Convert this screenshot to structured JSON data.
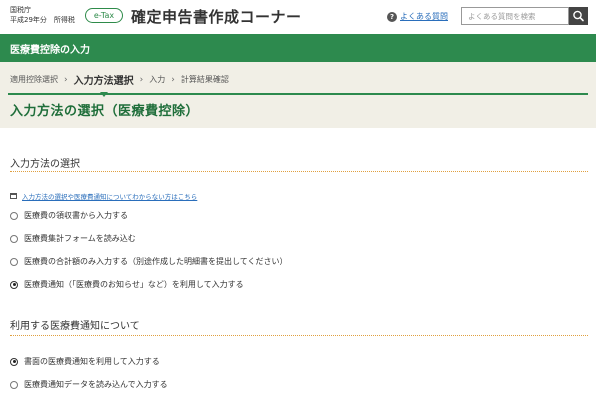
{
  "header": {
    "agency": "国税庁",
    "year": "平成29年分　所得税",
    "etax_badge": "e-Tax",
    "site_title": "確定申告書作成コーナー",
    "faq_link": "よくある質問",
    "search_placeholder": "よくある質問を検索"
  },
  "section_bar": {
    "title": "医療費控除の入力"
  },
  "steps": [
    {
      "label": "適用控除選択",
      "current": false
    },
    {
      "label": "入力方法選択",
      "current": true
    },
    {
      "label": "入力",
      "current": false
    },
    {
      "label": "計算結果確認",
      "current": false
    }
  ],
  "page_title": "入力方法の選択（医療費控除）",
  "input_method": {
    "heading": "入力方法の選択",
    "help_link": "入力方法の選択や医療費通知についてわからない方はこちら",
    "options": [
      {
        "label": "医療費の領収書から入力する",
        "checked": false
      },
      {
        "label": "医療費集計フォームを読み込む",
        "checked": false
      },
      {
        "label": "医療費の合計額のみ入力する（別途作成した明細書を提出してください）",
        "checked": false
      },
      {
        "label": "医療費通知（「医療費のお知らせ」など）を利用して入力する",
        "checked": true
      }
    ]
  },
  "notice_usage": {
    "heading": "利用する医療費通知について",
    "options": [
      {
        "label": "書面の医療費通知を利用して入力する",
        "checked": true
      },
      {
        "label": "医療費通知データを読み込んで入力する",
        "checked": false
      }
    ]
  },
  "colors": {
    "brand_green": "#2d8a4e",
    "title_green": "#1f6e3a",
    "link_blue": "#2a6ebb",
    "step_bg": "#f1efe6",
    "dotted_orange": "#e0a040"
  }
}
